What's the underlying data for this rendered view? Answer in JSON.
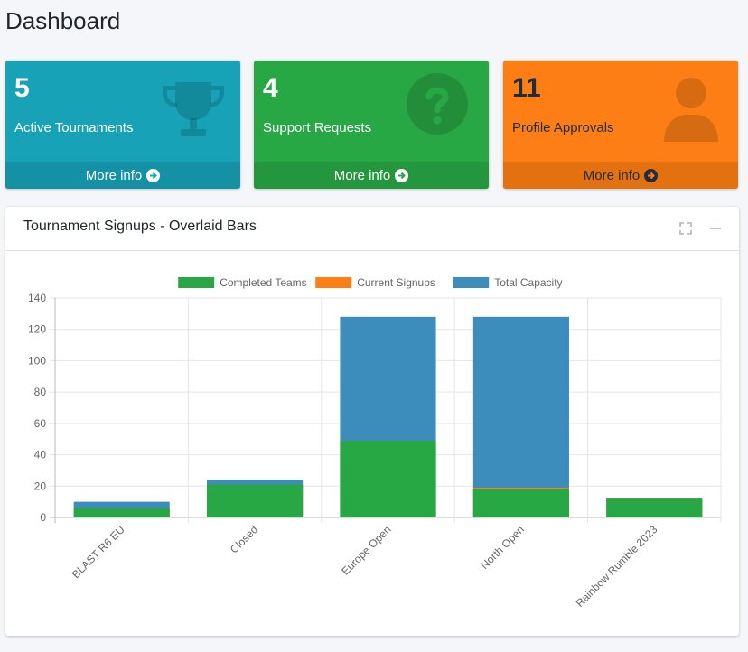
{
  "page": {
    "title": "Dashboard"
  },
  "boxes": [
    {
      "number": "5",
      "label": "Active Tournaments",
      "footer": "More info",
      "icon": "trophy-icon"
    },
    {
      "number": "4",
      "label": "Support Requests",
      "footer": "More info",
      "icon": "question-circle-icon"
    },
    {
      "number": "11",
      "label": "Profile Approvals",
      "footer": "More info",
      "icon": "user-icon"
    }
  ],
  "card": {
    "title": "Tournament Signups - Overlaid Bars"
  },
  "colors": {
    "completed": "#28a745",
    "current": "#fd7e14",
    "total": "#3c8dbc"
  },
  "chart_data": {
    "type": "bar",
    "categories": [
      "BLAST R6 EU",
      "Closed",
      "Europe Open",
      "North Open",
      "Rainbow Rumble 2023"
    ],
    "series": [
      {
        "name": "Completed Teams",
        "values": [
          6,
          21,
          49,
          18,
          12
        ]
      },
      {
        "name": "Current Signups",
        "values": [
          6,
          21,
          49,
          19,
          12
        ]
      },
      {
        "name": "Total Capacity",
        "values": [
          10,
          24,
          128,
          128,
          12
        ]
      }
    ],
    "ylim": [
      0,
      140
    ],
    "yticks": [
      0,
      20,
      40,
      60,
      80,
      100,
      120,
      140
    ],
    "grid": true,
    "legend": "top"
  }
}
